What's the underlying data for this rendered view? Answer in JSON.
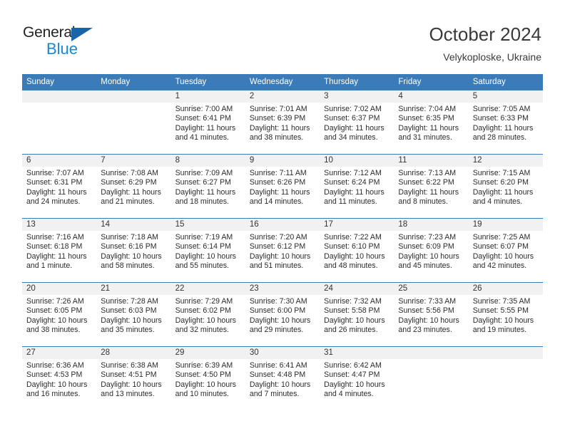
{
  "brand": {
    "name_top": "General",
    "name_bottom": "Blue",
    "triangle_color": "#1565a8",
    "blue_color": "#1b87d2"
  },
  "header": {
    "title": "October 2024",
    "subtitle": "Velykoploske, Ukraine"
  },
  "theme": {
    "header_bg": "#3b7cb8",
    "daynum_bg": "#f1f1f1",
    "row_border": "#3b7cb8"
  },
  "weekdays": [
    "Sunday",
    "Monday",
    "Tuesday",
    "Wednesday",
    "Thursday",
    "Friday",
    "Saturday"
  ],
  "weeks": [
    [
      {
        "day": "",
        "sunrise": "",
        "sunset": "",
        "daylight": "",
        "blank": true
      },
      {
        "day": "",
        "sunrise": "",
        "sunset": "",
        "daylight": "",
        "blank": true
      },
      {
        "day": "1",
        "sunrise": "Sunrise: 7:00 AM",
        "sunset": "Sunset: 6:41 PM",
        "daylight": "Daylight: 11 hours and 41 minutes."
      },
      {
        "day": "2",
        "sunrise": "Sunrise: 7:01 AM",
        "sunset": "Sunset: 6:39 PM",
        "daylight": "Daylight: 11 hours and 38 minutes."
      },
      {
        "day": "3",
        "sunrise": "Sunrise: 7:02 AM",
        "sunset": "Sunset: 6:37 PM",
        "daylight": "Daylight: 11 hours and 34 minutes."
      },
      {
        "day": "4",
        "sunrise": "Sunrise: 7:04 AM",
        "sunset": "Sunset: 6:35 PM",
        "daylight": "Daylight: 11 hours and 31 minutes."
      },
      {
        "day": "5",
        "sunrise": "Sunrise: 7:05 AM",
        "sunset": "Sunset: 6:33 PM",
        "daylight": "Daylight: 11 hours and 28 minutes."
      }
    ],
    [
      {
        "day": "6",
        "sunrise": "Sunrise: 7:07 AM",
        "sunset": "Sunset: 6:31 PM",
        "daylight": "Daylight: 11 hours and 24 minutes."
      },
      {
        "day": "7",
        "sunrise": "Sunrise: 7:08 AM",
        "sunset": "Sunset: 6:29 PM",
        "daylight": "Daylight: 11 hours and 21 minutes."
      },
      {
        "day": "8",
        "sunrise": "Sunrise: 7:09 AM",
        "sunset": "Sunset: 6:27 PM",
        "daylight": "Daylight: 11 hours and 18 minutes."
      },
      {
        "day": "9",
        "sunrise": "Sunrise: 7:11 AM",
        "sunset": "Sunset: 6:26 PM",
        "daylight": "Daylight: 11 hours and 14 minutes."
      },
      {
        "day": "10",
        "sunrise": "Sunrise: 7:12 AM",
        "sunset": "Sunset: 6:24 PM",
        "daylight": "Daylight: 11 hours and 11 minutes."
      },
      {
        "day": "11",
        "sunrise": "Sunrise: 7:13 AM",
        "sunset": "Sunset: 6:22 PM",
        "daylight": "Daylight: 11 hours and 8 minutes."
      },
      {
        "day": "12",
        "sunrise": "Sunrise: 7:15 AM",
        "sunset": "Sunset: 6:20 PM",
        "daylight": "Daylight: 11 hours and 4 minutes."
      }
    ],
    [
      {
        "day": "13",
        "sunrise": "Sunrise: 7:16 AM",
        "sunset": "Sunset: 6:18 PM",
        "daylight": "Daylight: 11 hours and 1 minute."
      },
      {
        "day": "14",
        "sunrise": "Sunrise: 7:18 AM",
        "sunset": "Sunset: 6:16 PM",
        "daylight": "Daylight: 10 hours and 58 minutes."
      },
      {
        "day": "15",
        "sunrise": "Sunrise: 7:19 AM",
        "sunset": "Sunset: 6:14 PM",
        "daylight": "Daylight: 10 hours and 55 minutes."
      },
      {
        "day": "16",
        "sunrise": "Sunrise: 7:20 AM",
        "sunset": "Sunset: 6:12 PM",
        "daylight": "Daylight: 10 hours and 51 minutes."
      },
      {
        "day": "17",
        "sunrise": "Sunrise: 7:22 AM",
        "sunset": "Sunset: 6:10 PM",
        "daylight": "Daylight: 10 hours and 48 minutes."
      },
      {
        "day": "18",
        "sunrise": "Sunrise: 7:23 AM",
        "sunset": "Sunset: 6:09 PM",
        "daylight": "Daylight: 10 hours and 45 minutes."
      },
      {
        "day": "19",
        "sunrise": "Sunrise: 7:25 AM",
        "sunset": "Sunset: 6:07 PM",
        "daylight": "Daylight: 10 hours and 42 minutes."
      }
    ],
    [
      {
        "day": "20",
        "sunrise": "Sunrise: 7:26 AM",
        "sunset": "Sunset: 6:05 PM",
        "daylight": "Daylight: 10 hours and 38 minutes."
      },
      {
        "day": "21",
        "sunrise": "Sunrise: 7:28 AM",
        "sunset": "Sunset: 6:03 PM",
        "daylight": "Daylight: 10 hours and 35 minutes."
      },
      {
        "day": "22",
        "sunrise": "Sunrise: 7:29 AM",
        "sunset": "Sunset: 6:02 PM",
        "daylight": "Daylight: 10 hours and 32 minutes."
      },
      {
        "day": "23",
        "sunrise": "Sunrise: 7:30 AM",
        "sunset": "Sunset: 6:00 PM",
        "daylight": "Daylight: 10 hours and 29 minutes."
      },
      {
        "day": "24",
        "sunrise": "Sunrise: 7:32 AM",
        "sunset": "Sunset: 5:58 PM",
        "daylight": "Daylight: 10 hours and 26 minutes."
      },
      {
        "day": "25",
        "sunrise": "Sunrise: 7:33 AM",
        "sunset": "Sunset: 5:56 PM",
        "daylight": "Daylight: 10 hours and 23 minutes."
      },
      {
        "day": "26",
        "sunrise": "Sunrise: 7:35 AM",
        "sunset": "Sunset: 5:55 PM",
        "daylight": "Daylight: 10 hours and 19 minutes."
      }
    ],
    [
      {
        "day": "27",
        "sunrise": "Sunrise: 6:36 AM",
        "sunset": "Sunset: 4:53 PM",
        "daylight": "Daylight: 10 hours and 16 minutes."
      },
      {
        "day": "28",
        "sunrise": "Sunrise: 6:38 AM",
        "sunset": "Sunset: 4:51 PM",
        "daylight": "Daylight: 10 hours and 13 minutes."
      },
      {
        "day": "29",
        "sunrise": "Sunrise: 6:39 AM",
        "sunset": "Sunset: 4:50 PM",
        "daylight": "Daylight: 10 hours and 10 minutes."
      },
      {
        "day": "30",
        "sunrise": "Sunrise: 6:41 AM",
        "sunset": "Sunset: 4:48 PM",
        "daylight": "Daylight: 10 hours and 7 minutes."
      },
      {
        "day": "31",
        "sunrise": "Sunrise: 6:42 AM",
        "sunset": "Sunset: 4:47 PM",
        "daylight": "Daylight: 10 hours and 4 minutes."
      },
      {
        "day": "",
        "sunrise": "",
        "sunset": "",
        "daylight": "",
        "blank": true
      },
      {
        "day": "",
        "sunrise": "",
        "sunset": "",
        "daylight": "",
        "blank": true
      }
    ]
  ]
}
